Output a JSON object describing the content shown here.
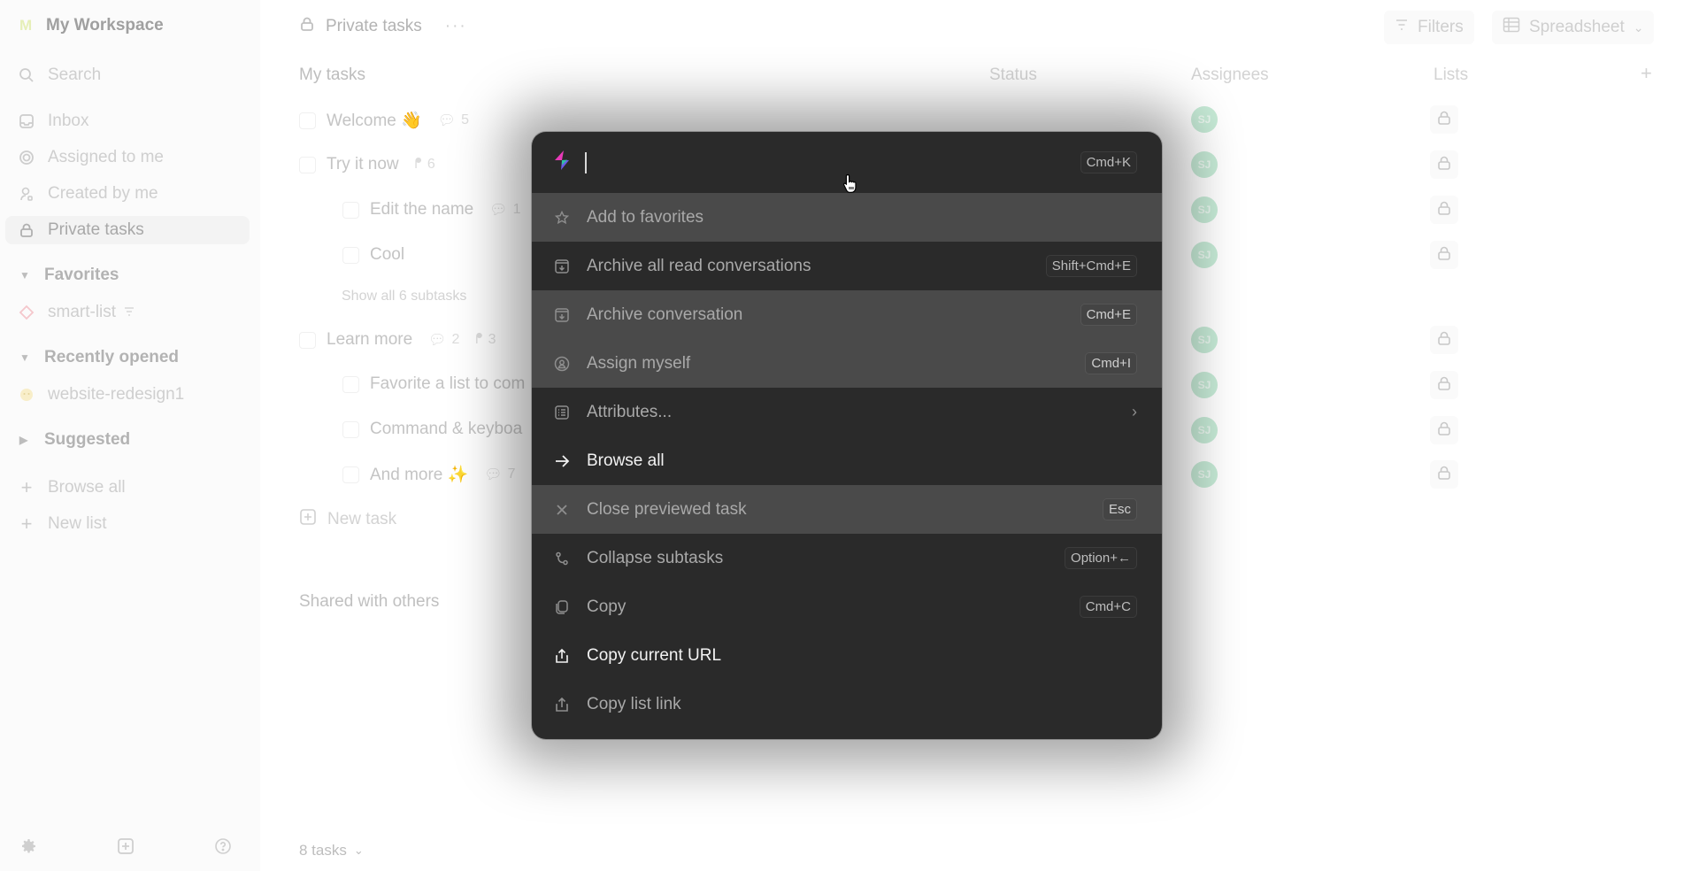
{
  "workspace": {
    "logo_letter": "M",
    "name": "My Workspace",
    "logo_color": "#e6efb8"
  },
  "sidebar": {
    "search_label": "Search",
    "nav": [
      {
        "label": "Inbox",
        "icon": "inbox-icon"
      },
      {
        "label": "Assigned to me",
        "icon": "target-icon"
      },
      {
        "label": "Created by me",
        "icon": "user-created-icon"
      },
      {
        "label": "Private tasks",
        "icon": "lock-icon",
        "active": true
      }
    ],
    "favorites": {
      "title": "Favorites",
      "items": [
        {
          "label": "smart-list",
          "icon": "diamond-icon"
        }
      ]
    },
    "recent": {
      "title": "Recently opened",
      "items": [
        {
          "label": "website-redesign1",
          "icon": "emoji-icon"
        }
      ]
    },
    "suggested": {
      "title": "Suggested"
    },
    "browse_all": "Browse all",
    "new_list": "New list"
  },
  "header": {
    "title": "Private tasks",
    "more": "···",
    "filters_label": "Filters",
    "view_label": "Spreadsheet"
  },
  "table": {
    "section_title": "My tasks",
    "columns": {
      "status": "Status",
      "assignees": "Assignees",
      "lists": "Lists",
      "add": "+"
    },
    "tasks": [
      {
        "title": "Welcome 👋",
        "comments": "5",
        "subtasks": "",
        "assignee": "SJ"
      },
      {
        "title": "Try it now",
        "comments": "",
        "subtasks": "6",
        "assignee": "SJ"
      },
      {
        "title": "Edit the name",
        "comments": "1",
        "subtasks": "",
        "assignee": "SJ",
        "child": true
      },
      {
        "title": "Cool",
        "comments": "",
        "subtasks": "",
        "assignee": "SJ",
        "child": true
      },
      {
        "title": "Learn more",
        "comments": "2",
        "subtasks": "3",
        "assignee": "SJ"
      },
      {
        "title": "Favorite a list to com",
        "comments": "",
        "subtasks": "",
        "assignee": "SJ",
        "child": true
      },
      {
        "title": "Command & keyboa",
        "comments": "",
        "subtasks": "",
        "assignee": "SJ",
        "child": true
      },
      {
        "title": "And more ✨",
        "comments": "7",
        "subtasks": "",
        "assignee": "SJ",
        "child": true
      }
    ],
    "show_all_subtasks": "Show all 6 subtasks",
    "new_task": "New task",
    "shared_title": "Shared with others",
    "task_count": "8 tasks"
  },
  "palette": {
    "input_value": "",
    "shortcut": "Cmd+K",
    "items": [
      {
        "label": "Add to favorites",
        "icon": "star-icon",
        "shortcut": "",
        "highlight": true
      },
      {
        "label": "Archive all read conversations",
        "icon": "archive-icon",
        "shortcut": "Shift+Cmd+E"
      },
      {
        "label": "Archive conversation",
        "icon": "archive-icon",
        "shortcut": "Cmd+E",
        "highlight": true
      },
      {
        "label": "Assign myself",
        "icon": "user-circle-icon",
        "shortcut": "Cmd+I",
        "highlight": true
      },
      {
        "label": "Attributes...",
        "icon": "list-icon",
        "submenu": true
      },
      {
        "label": "Browse all",
        "icon": "arrow-right-icon",
        "bright": true
      },
      {
        "label": "Close previewed task",
        "icon": "close-icon",
        "shortcut": "Esc",
        "highlight": true
      },
      {
        "label": "Collapse subtasks",
        "icon": "subtasks-icon",
        "shortcut": "Option+←"
      },
      {
        "label": "Copy",
        "icon": "copy-icon",
        "shortcut": "Cmd+C"
      },
      {
        "label": "Copy current URL",
        "icon": "share-icon",
        "bright": true
      },
      {
        "label": "Copy list link",
        "icon": "share-icon"
      }
    ]
  }
}
